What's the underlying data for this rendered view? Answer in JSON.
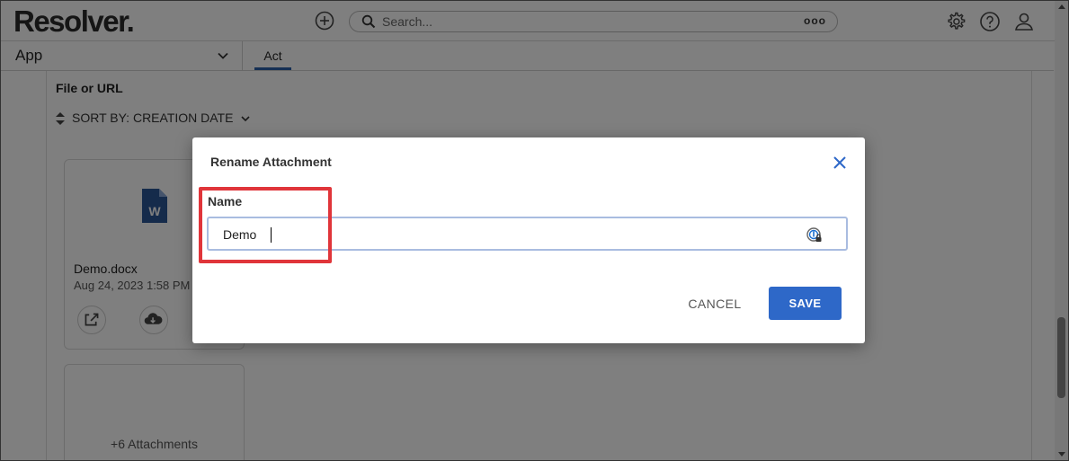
{
  "header": {
    "logo": "Resolver.",
    "search_placeholder": "Search...",
    "search_more": "ooo"
  },
  "subbar": {
    "app_label": "App",
    "active_tab": "Act"
  },
  "page": {
    "field_label": "File or URL",
    "sort_label": "SORT BY: CREATION DATE",
    "attachments": [
      {
        "name": "Demo.docx",
        "date": "Aug 24, 2023 1:58 PM"
      }
    ],
    "more_attachments": "+6 Attachments"
  },
  "modal": {
    "title": "Rename Attachment",
    "name_label": "Name",
    "name_value": "Demo",
    "cancel_label": "CANCEL",
    "save_label": "SAVE"
  },
  "colors": {
    "accent": "#2e68c8",
    "highlight": "#e0353a",
    "word_icon": "#2b5797"
  },
  "icons": [
    "add-circle-icon",
    "search-icon",
    "gear-icon",
    "help-icon",
    "user-icon",
    "chevron-down-icon",
    "sort-arrows-icon",
    "word-doc-icon",
    "open-external-icon",
    "cloud-download-icon",
    "close-icon",
    "password-manager-icon"
  ]
}
